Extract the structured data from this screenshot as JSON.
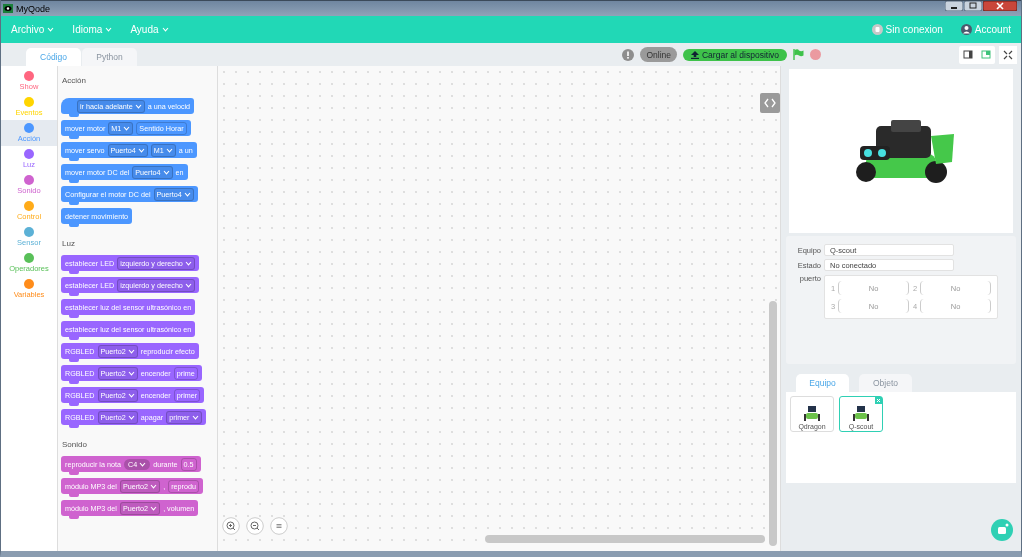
{
  "window": {
    "title": "MyQode"
  },
  "menu": [
    {
      "label": "Archivo"
    },
    {
      "label": "Idioma"
    },
    {
      "label": "Ayuda"
    }
  ],
  "connection": {
    "label": "Sin conexion"
  },
  "account": {
    "label": "Account"
  },
  "editor_tabs": [
    {
      "label": "Código",
      "selected": true
    },
    {
      "label": "Python",
      "selected": false
    }
  ],
  "toolbar": {
    "mode": "Online",
    "upload": "Cargar al dispositivo"
  },
  "categories": [
    {
      "label": "Show",
      "color": "#ff6680",
      "selected": false
    },
    {
      "label": "Eventos",
      "color": "#ffd500",
      "selected": false
    },
    {
      "label": "Acción",
      "color": "#4c97ff",
      "selected": true
    },
    {
      "label": "Luz",
      "color": "#9966ff",
      "selected": false
    },
    {
      "label": "Sonido",
      "color": "#cf63cf",
      "selected": false
    },
    {
      "label": "Control",
      "color": "#ffab19",
      "selected": false
    },
    {
      "label": "Sensor",
      "color": "#5cb1d6",
      "selected": false
    },
    {
      "label": "Operadores",
      "color": "#59c059",
      "selected": false
    },
    {
      "label": "Variables",
      "color": "#ff8c1a",
      "selected": false
    }
  ],
  "sections": [
    {
      "title": "Acción",
      "color": "#4c97ff",
      "blocks": [
        {
          "kind": "hat",
          "segments": [
            {
              "kind": "dropdown",
              "text": "ir hacia adelante"
            },
            {
              "kind": "text",
              "text": "a una velocid"
            }
          ]
        },
        {
          "kind": "stack",
          "segments": [
            {
              "kind": "text",
              "text": "mover motor"
            },
            {
              "kind": "dropdown",
              "text": "M1"
            },
            {
              "kind": "field",
              "text": "Sentido Horar"
            }
          ]
        },
        {
          "kind": "stack",
          "segments": [
            {
              "kind": "text",
              "text": "mover servo"
            },
            {
              "kind": "dropdown",
              "text": "Puerto4"
            },
            {
              "kind": "dropdown",
              "text": "M1"
            },
            {
              "kind": "text",
              "text": "a un"
            }
          ]
        },
        {
          "kind": "stack",
          "segments": [
            {
              "kind": "text",
              "text": "mover motor DC del"
            },
            {
              "kind": "dropdown",
              "text": "Puerto4"
            },
            {
              "kind": "text",
              "text": "en"
            }
          ]
        },
        {
          "kind": "stack",
          "segments": [
            {
              "kind": "text",
              "text": "Configurar el motor DC del"
            },
            {
              "kind": "dropdown",
              "text": "Puerto4"
            }
          ]
        },
        {
          "kind": "stack",
          "segments": [
            {
              "kind": "text",
              "text": "detener movimiento"
            }
          ]
        }
      ]
    },
    {
      "title": "Luz",
      "color": "#9966ff",
      "blocks": [
        {
          "kind": "stack",
          "segments": [
            {
              "kind": "text",
              "text": "establecer LED"
            },
            {
              "kind": "dropdown",
              "text": "izquierdo y derecho"
            }
          ]
        },
        {
          "kind": "stack",
          "segments": [
            {
              "kind": "text",
              "text": "establecer LED"
            },
            {
              "kind": "dropdown",
              "text": "izquierdo y derecho"
            }
          ]
        },
        {
          "kind": "stack",
          "segments": [
            {
              "kind": "text",
              "text": "establecer luz del sensor ultrasónico en"
            }
          ]
        },
        {
          "kind": "stack",
          "segments": [
            {
              "kind": "text",
              "text": "establecer luz del sensor ultrasónico en"
            }
          ]
        },
        {
          "kind": "stack",
          "segments": [
            {
              "kind": "text",
              "text": "RGBLED"
            },
            {
              "kind": "dropdown",
              "text": "Puerto2"
            },
            {
              "kind": "text",
              "text": "reproducir efecto"
            }
          ]
        },
        {
          "kind": "stack",
          "segments": [
            {
              "kind": "text",
              "text": "RGBLED"
            },
            {
              "kind": "dropdown",
              "text": "Puerto2"
            },
            {
              "kind": "text",
              "text": "encender"
            },
            {
              "kind": "field",
              "text": "prime"
            }
          ]
        },
        {
          "kind": "stack",
          "segments": [
            {
              "kind": "text",
              "text": "RGBLED"
            },
            {
              "kind": "dropdown",
              "text": "Puerto2"
            },
            {
              "kind": "text",
              "text": "encender"
            },
            {
              "kind": "field",
              "text": "primer"
            }
          ]
        },
        {
          "kind": "stack",
          "segments": [
            {
              "kind": "text",
              "text": "RGBLED"
            },
            {
              "kind": "dropdown",
              "text": "Puerto2"
            },
            {
              "kind": "text",
              "text": "apagar"
            },
            {
              "kind": "dropdown",
              "text": "primer"
            }
          ]
        }
      ]
    },
    {
      "title": "Sonido",
      "color": "#cf63cf",
      "blocks": [
        {
          "kind": "stack",
          "segments": [
            {
              "kind": "text",
              "text": "reproducir la nota"
            },
            {
              "kind": "round",
              "text": "C4"
            },
            {
              "kind": "text",
              "text": "durante"
            },
            {
              "kind": "field",
              "text": "0.5"
            }
          ]
        },
        {
          "kind": "stack",
          "segments": [
            {
              "kind": "text",
              "text": "módulo MP3 del"
            },
            {
              "kind": "dropdown",
              "text": "Puerto2"
            },
            {
              "kind": "text",
              "text": ","
            },
            {
              "kind": "field",
              "text": "reprodu"
            }
          ]
        },
        {
          "kind": "stack",
          "segments": [
            {
              "kind": "text",
              "text": "módulo MP3 del"
            },
            {
              "kind": "dropdown",
              "text": "Puerto2"
            },
            {
              "kind": "text",
              "text": ", volumen"
            }
          ]
        }
      ]
    }
  ],
  "device": {
    "fields": [
      {
        "label": "Equipo",
        "value": "Q-scout"
      },
      {
        "label": "Estado",
        "value": "No conectado"
      }
    ],
    "ports_label": "puerto",
    "ports": [
      {
        "number": "1",
        "value": "No"
      },
      {
        "number": "2",
        "value": "No"
      },
      {
        "number": "3",
        "value": "No"
      },
      {
        "number": "4",
        "value": "No"
      }
    ]
  },
  "device_tabs": [
    {
      "label": "Equipo",
      "selected": true
    },
    {
      "label": "Objeto",
      "selected": false
    }
  ],
  "devices": [
    {
      "label": "Qdragon",
      "selected": false
    },
    {
      "label": "Q-scout",
      "selected": true
    }
  ]
}
